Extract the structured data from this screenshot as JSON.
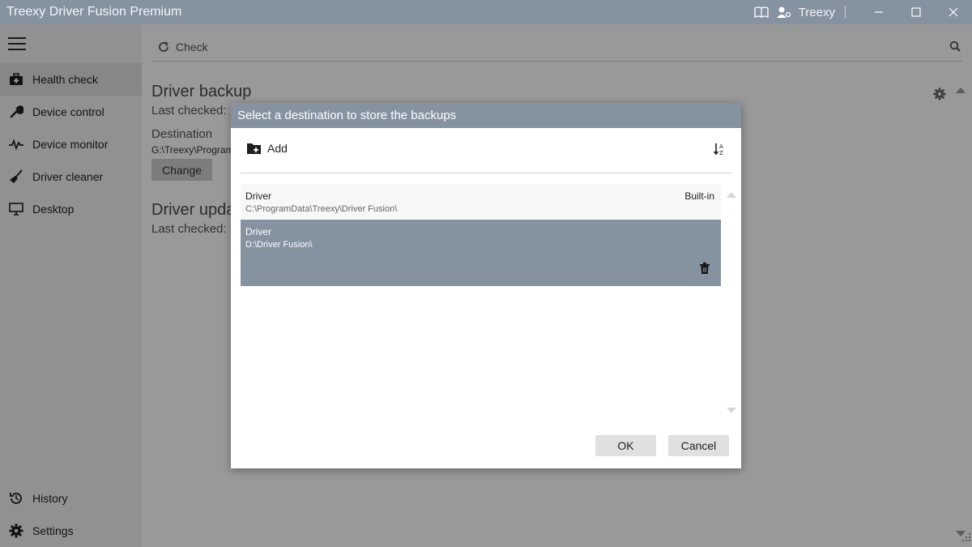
{
  "window": {
    "title": "Treexy Driver Fusion Premium",
    "user_name": "Treexy",
    "accent_color": "#8592a0"
  },
  "sidebar": {
    "items": [
      {
        "label": "Health check",
        "icon": "first-aid-kit-icon",
        "active": true
      },
      {
        "label": "Device control",
        "icon": "wrench-icon"
      },
      {
        "label": "Device monitor",
        "icon": "pulse-icon"
      },
      {
        "label": "Driver cleaner",
        "icon": "broom-icon"
      },
      {
        "label": "Desktop",
        "icon": "monitor-icon"
      }
    ],
    "bottom_items": [
      {
        "label": "History",
        "icon": "history-icon"
      },
      {
        "label": "Settings",
        "icon": "gear-icon"
      }
    ]
  },
  "main": {
    "toolbar": {
      "check_label": "Check"
    },
    "backup": {
      "title": "Driver backup",
      "last_checked": "Last checked:",
      "destination_label": "Destination",
      "destination_path": "G:\\Treexy\\Program",
      "change_label": "Change"
    },
    "update": {
      "title": "Driver upda",
      "last_checked": "Last checked:"
    }
  },
  "dialog": {
    "title": "Select a destination to store the backups",
    "add_label": "Add",
    "items": [
      {
        "name": "Driver",
        "path": "C:\\ProgramData\\Treexy\\Driver Fusion\\",
        "badge": "Built-in"
      },
      {
        "name": "Driver",
        "path": "D:\\Driver Fusion\\",
        "selected": true
      }
    ],
    "ok_label": "OK",
    "cancel_label": "Cancel"
  }
}
